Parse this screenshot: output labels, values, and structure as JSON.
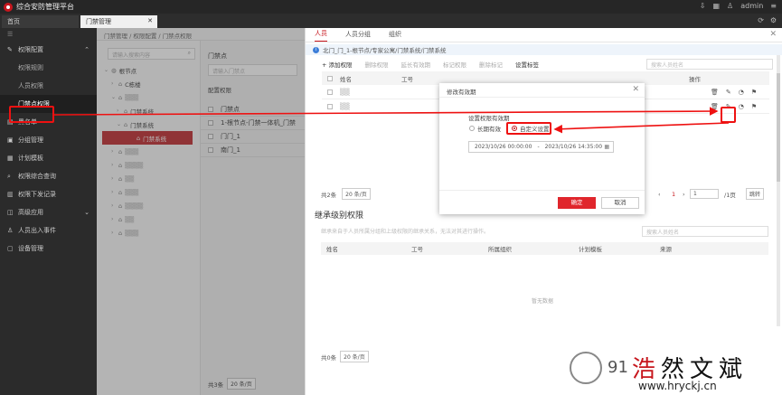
{
  "app": {
    "title": "综合安防管理平台",
    "user": "admin"
  },
  "tabs": [
    {
      "label": "首页"
    },
    {
      "label": "门禁管理"
    }
  ],
  "sidebar": {
    "items": [
      {
        "label": "权限配置",
        "icon": "wrench-icon"
      },
      {
        "label": "权限规则"
      },
      {
        "label": "人员权限"
      },
      {
        "label": "门禁点权限"
      },
      {
        "label": "黑名单"
      },
      {
        "label": "分组管理"
      },
      {
        "label": "计划模板"
      },
      {
        "label": "权限综合查询"
      },
      {
        "label": "权限下发记录"
      },
      {
        "label": "高级应用"
      },
      {
        "label": "人员出入事件"
      },
      {
        "label": "设备管理"
      }
    ]
  },
  "breadcrumb": "门禁管理 / 权限配置 / 门禁点权限",
  "tree": {
    "search_placeholder": "请输入搜索内容",
    "nodes": [
      {
        "label": "根节点"
      },
      {
        "label": "C栋楼"
      },
      {
        "label": "门禁系统"
      },
      {
        "label": "门禁系统"
      },
      {
        "label": "门禁系统"
      }
    ]
  },
  "doors": {
    "title": "门禁点",
    "search_placeholder": "请输入门禁点",
    "config_label": "配置权限",
    "rows": [
      "门禁点",
      "1-根节点-门禁一体机_门禁",
      "门门_1",
      "南门_1"
    ],
    "pager": {
      "total": "共3条",
      "size": "20 条/页"
    }
  },
  "right": {
    "tabs": [
      "人员",
      "人员分组",
      "组织"
    ],
    "info": "北门_门_1-根节点/专家公寓/门禁系统/门禁系统",
    "toolbar": [
      "+ 添加权限",
      "删除权限",
      "延长有效期",
      "标记权限",
      "删除标记",
      "设置标签"
    ],
    "person_search": "搜索人员姓名",
    "columns": [
      "姓名",
      "工号",
      "操作"
    ],
    "pager": {
      "total": "共2条",
      "size": "20 条/页",
      "page": "1",
      "pages": "/1页",
      "jump": "跳转"
    },
    "inherit_title": "继承级别权限",
    "inherit_desc": "继承来自于人员所属分组和上级权限的继承关系，无法对其进行操作。",
    "inherit_search": "搜索人员姓名",
    "inherit_columns": [
      "姓名",
      "工号",
      "所属组织",
      "计划模板",
      "来源"
    ],
    "empty": "暂无数据",
    "pager2": {
      "total": "共0条",
      "size": "20 条/页"
    }
  },
  "modal": {
    "title": "修改有效期",
    "label": "设置权限有效期",
    "options": [
      "长期有效",
      "自定义设置"
    ],
    "start": "2023/10/26 00:00:00",
    "sep": "-",
    "end": "2023/10/26 14:35:00",
    "ok": "确定",
    "cancel": "取消"
  },
  "watermark": {
    "num": "91",
    "brand": [
      "浩",
      "然",
      "文",
      "斌"
    ],
    "url": "www.hryckj.cn"
  },
  "colors": {
    "accent": "#c7161d",
    "highlight": "#e11111"
  }
}
